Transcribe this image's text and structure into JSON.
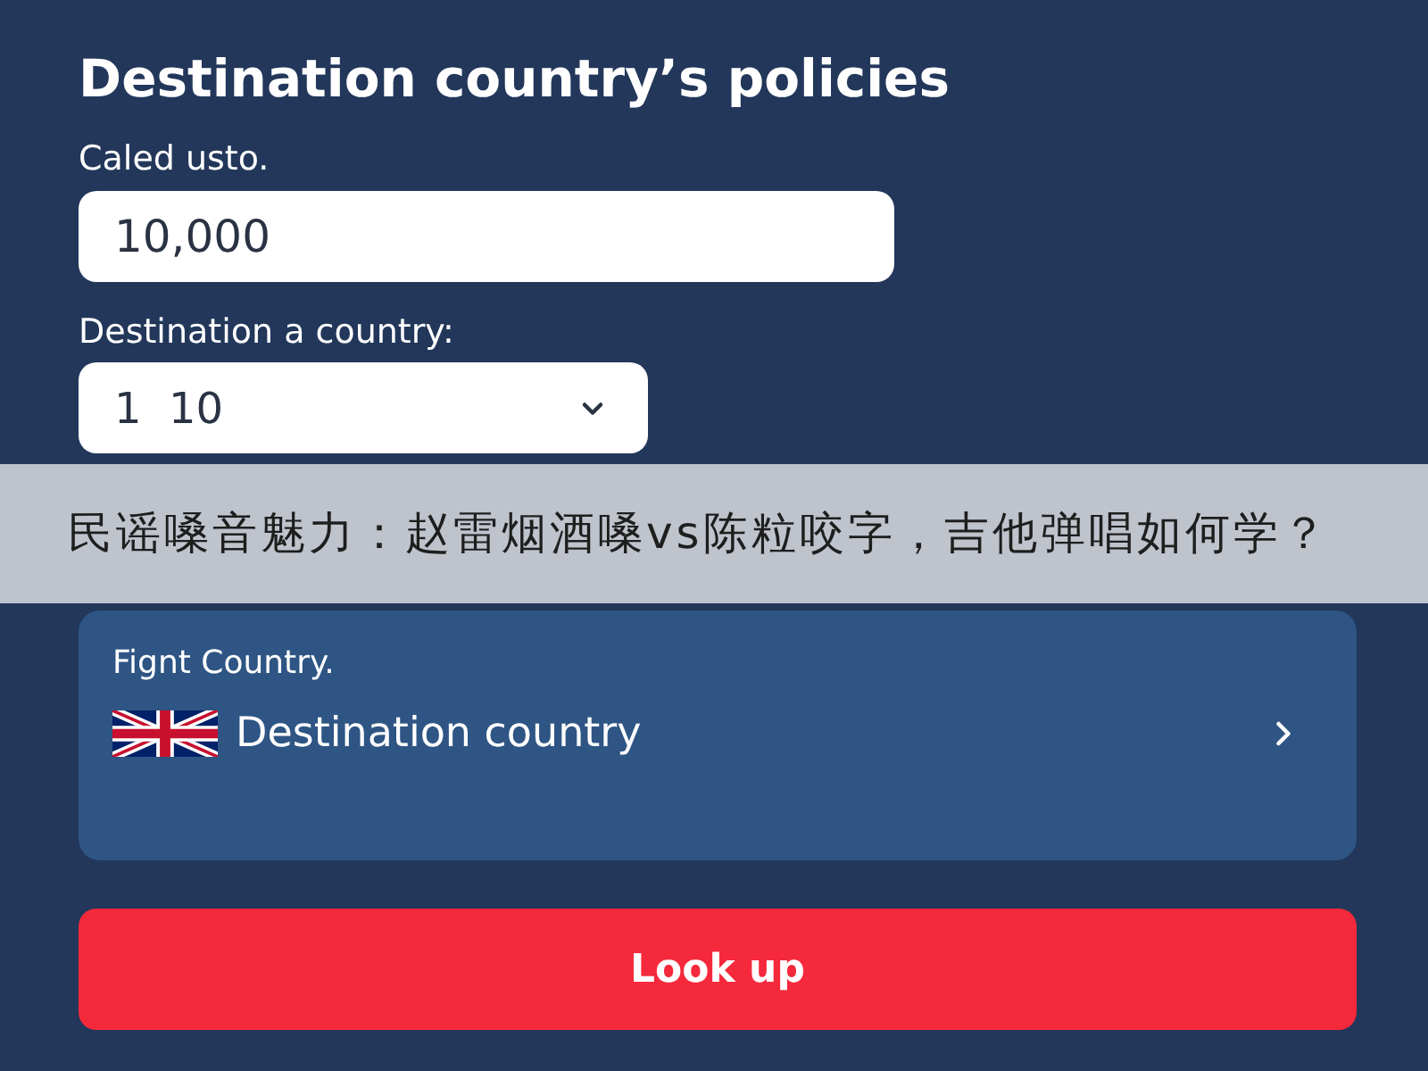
{
  "heading": "Destination country’s policies",
  "fields": [
    {
      "kind": "input",
      "label": "Caled usto.",
      "value": "10,000"
    },
    {
      "kind": "select",
      "label": "Destination a country:",
      "value": "1  10"
    }
  ],
  "destination_card": {
    "label": "Fignt Country.",
    "country": "Destination country"
  },
  "lookup_button": "Look up",
  "caption_banner": "民谣嗓音魅力：赵雷烟酒嗓vs陈粒咬字，吉他弹唱如何学？"
}
